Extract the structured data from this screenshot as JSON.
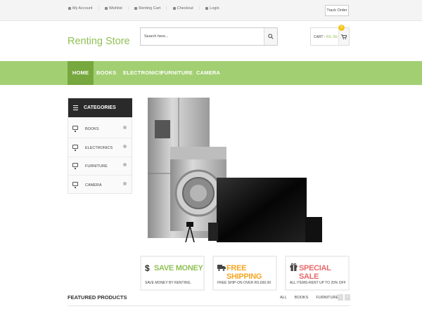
{
  "topbar": {
    "links": [
      {
        "label": "My Account",
        "icon": "user-icon"
      },
      {
        "label": "Wishlist",
        "icon": "heart-icon"
      },
      {
        "label": "Renting Cart",
        "icon": "cart-icon"
      },
      {
        "label": "Checkout",
        "icon": "check-icon"
      },
      {
        "label": "Login",
        "icon": "login-icon"
      }
    ],
    "track_order": "Track Order"
  },
  "header": {
    "logo": "Renting Store",
    "search_placeholder": "Search here...",
    "cart_label": "CART - ",
    "cart_amount": "RS. 00.00",
    "cart_count": "0"
  },
  "nav": {
    "items": [
      "HOME",
      "BOOKS",
      "ELECTRONICS",
      "FURNITURE",
      "CAMERA"
    ]
  },
  "categories": {
    "title": "CATEGORIES",
    "items": [
      "BOOKS",
      "ELECTRONICS",
      "FURNITURE",
      "CAMERA"
    ]
  },
  "features": [
    {
      "title": "SAVE MONEY",
      "subtitle": "SAVE MONEY BY RENTING.",
      "color": "#90c055",
      "icon": "dollar-icon"
    },
    {
      "title": "FREE SHIPPING",
      "subtitle": "FREE SHIP-ON OVER RS.600.00",
      "color": "#f5a623",
      "icon": "truck-icon"
    },
    {
      "title": "SPECIAL SALE",
      "subtitle": "ALL ITEMS-RENT UP TO 20% OFF",
      "color": "#e8686a",
      "icon": "gift-icon"
    }
  ],
  "featured": {
    "title": "FEATURED PRODUCTS",
    "tabs": [
      "ALL",
      "BOOKS",
      "FURNITURE"
    ]
  },
  "colors": {
    "accent": "#a2cf72",
    "accent_dark": "#77a83f",
    "logo": "#90c055",
    "dark": "#2a2a2a"
  }
}
